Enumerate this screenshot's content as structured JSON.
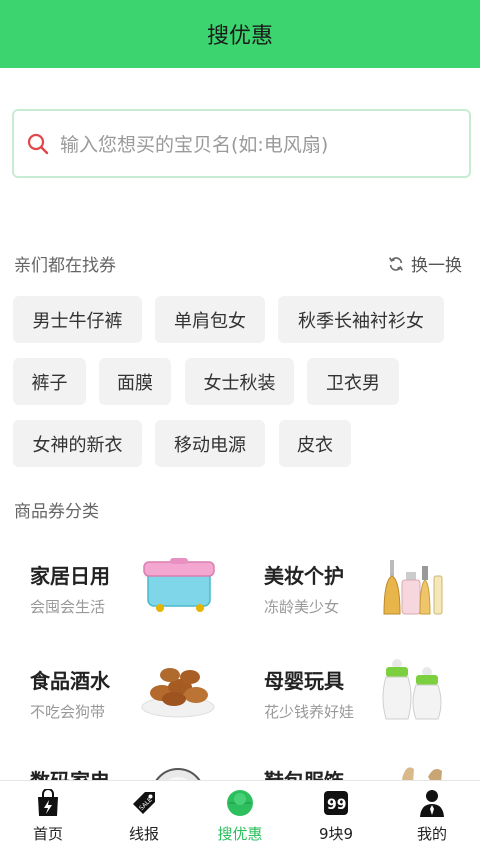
{
  "header": {
    "title": "搜优惠"
  },
  "search": {
    "placeholder": "输入您想买的宝贝名(如:电风扇)"
  },
  "hot": {
    "label": "亲们都在找券",
    "refresh_label": "换一换",
    "tags": [
      "男士牛仔裤",
      "单肩包女",
      "秋季长袖衬衫女",
      "裤子",
      "面膜",
      "女士秋装",
      "卫衣男",
      "女神的新衣",
      "移动电源",
      "皮衣"
    ]
  },
  "categories": {
    "label": "商品券分类",
    "items": [
      {
        "name": "家居日用",
        "sub": "会囤会生活",
        "icon": "storage-box-icon"
      },
      {
        "name": "美妆个护",
        "sub": "冻龄美少女",
        "icon": "perfume-icon"
      },
      {
        "name": "食品酒水",
        "sub": "不吃会狗带",
        "icon": "nuts-icon"
      },
      {
        "name": "母婴玩具",
        "sub": "花少钱养好娃",
        "icon": "baby-bottle-icon"
      },
      {
        "name": "数码家电",
        "sub": "",
        "icon": "appliance-icon"
      },
      {
        "name": "鞋包服饰",
        "sub": "",
        "icon": "fashion-icon"
      }
    ]
  },
  "tabbar": {
    "active": 2,
    "items": [
      {
        "label": "首页",
        "icon": "shopping-bag-icon"
      },
      {
        "label": "线报",
        "icon": "sale-tag-icon"
      },
      {
        "label": "搜优惠",
        "icon": "search-circle-icon"
      },
      {
        "label": "9块9",
        "icon": "nine-nine-icon"
      },
      {
        "label": "我的",
        "icon": "user-icon"
      }
    ]
  },
  "colors": {
    "brand": "#3bd46f",
    "active_tab": "#2dbf5e",
    "search_icon": "#e0464a"
  }
}
